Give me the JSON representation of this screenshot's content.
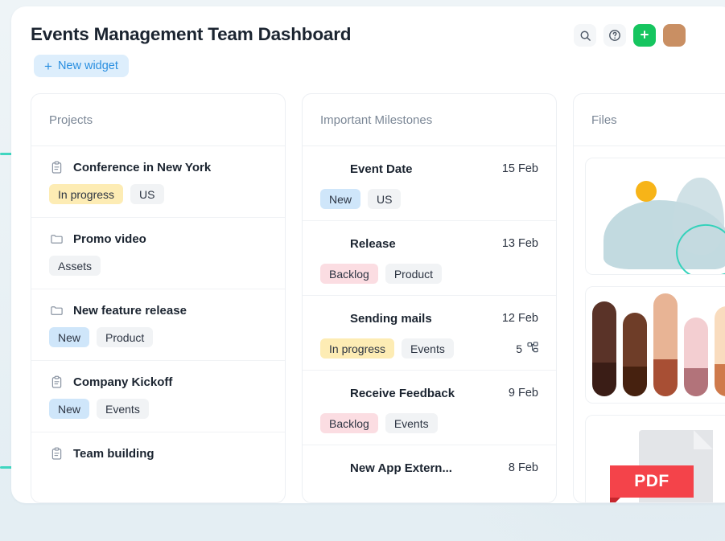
{
  "header": {
    "title": "Events Management Team Dashboard",
    "new_widget_label": "New widget",
    "new_widget_plus": "+",
    "actions": [
      {
        "name": "search-icon",
        "label": "Search"
      },
      {
        "name": "help-icon",
        "label": "Help"
      },
      {
        "name": "add-icon",
        "label": "Add"
      },
      {
        "name": "avatar",
        "label": "Account"
      }
    ]
  },
  "cards": {
    "projects": {
      "title": "Projects",
      "rows": [
        {
          "icon": "clipboard-icon",
          "name": "Conference in New York",
          "tags": [
            {
              "label": "In progress",
              "color": "yellow"
            },
            {
              "label": "US",
              "color": "gray"
            }
          ]
        },
        {
          "icon": "folder-icon",
          "name": "Promo video",
          "tags": [
            {
              "label": "Assets",
              "color": "gray"
            }
          ]
        },
        {
          "icon": "folder-icon",
          "name": "New feature release",
          "tags": [
            {
              "label": "New",
              "color": "blue"
            },
            {
              "label": "Product",
              "color": "gray"
            }
          ]
        },
        {
          "icon": "clipboard-icon",
          "name": "Company Kickoff",
          "tags": [
            {
              "label": "New",
              "color": "blue"
            },
            {
              "label": "Events",
              "color": "gray"
            }
          ]
        },
        {
          "icon": "clipboard-icon",
          "name": "Team building",
          "tags": []
        }
      ]
    },
    "milestones": {
      "title": "Important Milestones",
      "rows": [
        {
          "name": "Event Date",
          "date": "15 Feb",
          "tags": [
            {
              "label": "New",
              "color": "blue"
            },
            {
              "label": "US",
              "color": "gray"
            }
          ],
          "subtasks": ""
        },
        {
          "name": "Release",
          "date": "13 Feb",
          "tags": [
            {
              "label": "Backlog",
              "color": "pink"
            },
            {
              "label": "Product",
              "color": "gray"
            }
          ],
          "subtasks": ""
        },
        {
          "name": "Sending mails",
          "date": "12 Feb",
          "tags": [
            {
              "label": "In progress",
              "color": "yellow"
            },
            {
              "label": "Events",
              "color": "gray"
            }
          ],
          "subtasks": "5"
        },
        {
          "name": "Receive Feedback",
          "date": "9 Feb",
          "tags": [
            {
              "label": "Backlog",
              "color": "pink"
            },
            {
              "label": "Events",
              "color": "gray"
            }
          ],
          "subtasks": ""
        },
        {
          "name": "New App Extern...",
          "date": "8 Feb",
          "tags": [],
          "subtasks": ""
        }
      ]
    },
    "files": {
      "title": "Files",
      "items": [
        {
          "name": "abstract-art-thumbnail",
          "kind": "image"
        },
        {
          "name": "color-swatch-thumbnail",
          "kind": "image"
        },
        {
          "name": "pdf-file-thumbnail",
          "kind": "pdf",
          "label": "PDF"
        }
      ]
    }
  },
  "colors": {
    "accent_green": "#16c55f",
    "accent_teal": "#3fd6c0",
    "link_blue": "#2a8fe0",
    "tag_yellow": "#fdecb4",
    "tag_blue": "#cfe6fa",
    "tag_pink": "#fbdde2",
    "tag_gray": "#f1f3f5",
    "pdf_red": "#f4434a",
    "page_bg": "#e8f0f4"
  }
}
